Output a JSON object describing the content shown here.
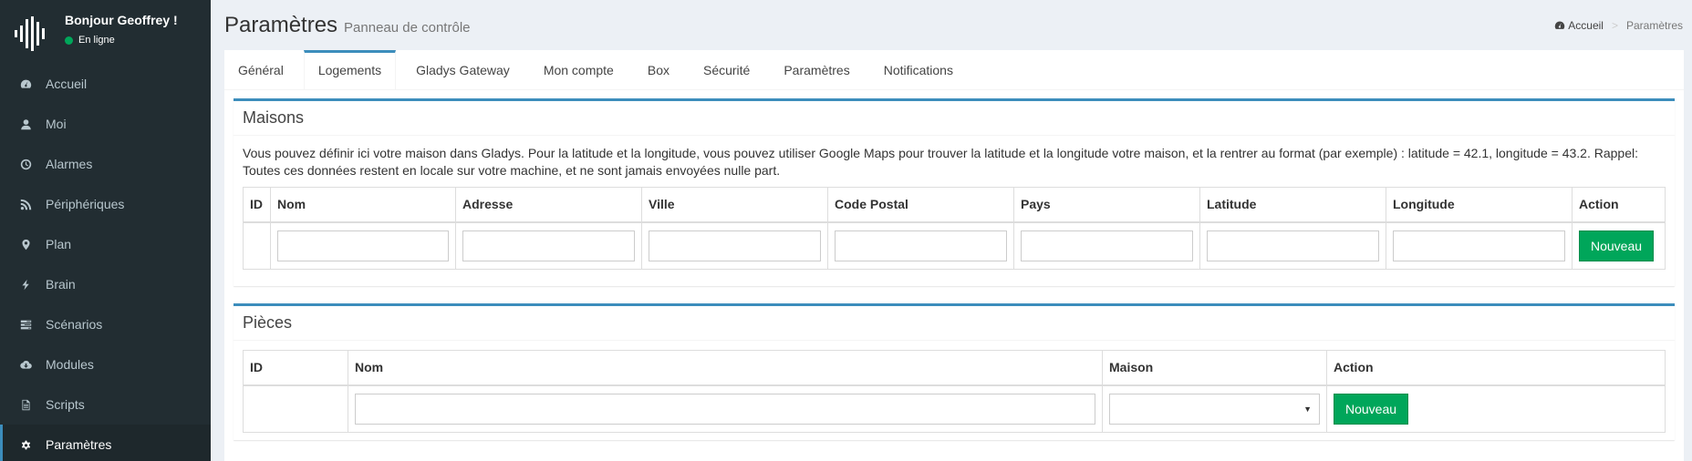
{
  "user": {
    "name": "Bonjour Geoffrey !",
    "status": "En ligne"
  },
  "menu": [
    {
      "label": "Accueil",
      "icon": "dashboard-icon"
    },
    {
      "label": "Moi",
      "icon": "user-icon"
    },
    {
      "label": "Alarmes",
      "icon": "clock-icon"
    },
    {
      "label": "Périphériques",
      "icon": "rss-icon"
    },
    {
      "label": "Plan",
      "icon": "map-marker-icon"
    },
    {
      "label": "Brain",
      "icon": "bolt-icon"
    },
    {
      "label": "Scénarios",
      "icon": "tasks-icon"
    },
    {
      "label": "Modules",
      "icon": "cloud-download-icon"
    },
    {
      "label": "Scripts",
      "icon": "file-icon"
    },
    {
      "label": "Paramètres",
      "icon": "gear-icon"
    }
  ],
  "header": {
    "title": "Paramètres",
    "subtitle": "Panneau de contrôle",
    "breadcrumb": {
      "home": "Accueil",
      "current": "Paramètres"
    }
  },
  "tabs": [
    "Général",
    "Logements",
    "Gladys Gateway",
    "Mon compte",
    "Box",
    "Sécurité",
    "Paramètres",
    "Notifications"
  ],
  "active_tab": "Logements",
  "houses": {
    "title": "Maisons",
    "description": "Vous pouvez définir ici votre maison dans Gladys. Pour la latitude et la longitude, vous pouvez utiliser Google Maps pour trouver la latitude et la longitude votre maison, et la rentrer au format (par exemple) : latitude = 42.1, longitude = 43.2. Rappel: Toutes ces données restent en locale sur votre machine, et ne sont jamais envoyées nulle part.",
    "columns": [
      "ID",
      "Nom",
      "Adresse",
      "Ville",
      "Code Postal",
      "Pays",
      "Latitude",
      "Longitude",
      "Action"
    ],
    "button": "Nouveau"
  },
  "rooms": {
    "title": "Pièces",
    "columns": [
      "ID",
      "Nom",
      "Maison",
      "Action"
    ],
    "button": "Nouveau"
  },
  "colors": {
    "sidebar": "#222d32",
    "accent": "#3c8dbc",
    "success": "#00a65a"
  }
}
